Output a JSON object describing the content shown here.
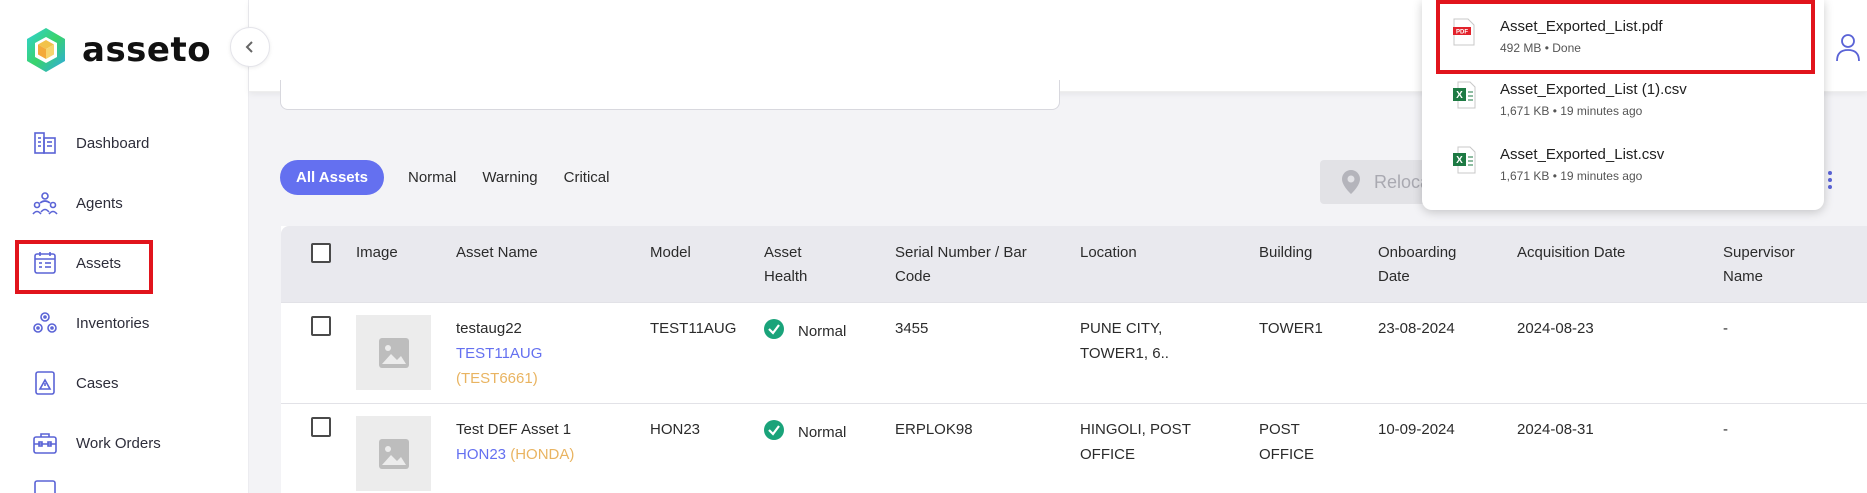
{
  "brand": {
    "name": "asseto"
  },
  "sidebar": {
    "items": [
      {
        "label": "Dashboard",
        "icon": "dashboard-icon"
      },
      {
        "label": "Agents",
        "icon": "agents-icon"
      },
      {
        "label": "Assets",
        "icon": "assets-icon",
        "highlighted": true
      },
      {
        "label": "Inventories",
        "icon": "inventories-icon"
      },
      {
        "label": "Cases",
        "icon": "cases-icon"
      },
      {
        "label": "Work Orders",
        "icon": "work-orders-icon"
      }
    ]
  },
  "tabs": [
    {
      "label": "All Assets",
      "active": true
    },
    {
      "label": "Normal"
    },
    {
      "label": "Warning"
    },
    {
      "label": "Critical"
    }
  ],
  "toolbar": {
    "relocate_label": "Reloca"
  },
  "table": {
    "headers": [
      "Image",
      "Asset Name",
      "Model",
      "Asset Health",
      "Serial Number / Bar Code",
      "Location",
      "Building",
      "Onboarding Date",
      "Acquisition Date",
      "Supervisor Name"
    ],
    "rows": [
      {
        "asset_name": "testaug22",
        "model_link": "TEST11AUG",
        "brand_link": "(TEST6661)",
        "model": "TEST11AUG",
        "health": "Normal",
        "serial": "3455",
        "location": "PUNE CITY, TOWER1, 6..",
        "building": "TOWER1",
        "onboarding": "23-08-2024",
        "acquisition": "2024-08-23",
        "supervisor": "-"
      },
      {
        "asset_name": "Test DEF Asset 1",
        "model_link": "HON23",
        "brand_link": "(HONDA)",
        "model": "HON23",
        "health": "Normal",
        "serial": "ERPLOK98",
        "location": "HINGOLI, POST OFFICE",
        "building": "POST OFFICE",
        "onboarding": "10-09-2024",
        "acquisition": "2024-08-31",
        "supervisor": "-"
      }
    ]
  },
  "downloads": {
    "items": [
      {
        "name": "Asset_Exported_List.pdf",
        "meta": "492 MB • Done",
        "type": "pdf"
      },
      {
        "name": "Asset_Exported_List (1).csv",
        "meta": "1,671 KB • 19 minutes ago",
        "type": "excel"
      },
      {
        "name": "Asset_Exported_List.csv",
        "meta": "1,671 KB • 19 minutes ago",
        "type": "excel"
      }
    ]
  },
  "colors": {
    "accent": "#6470f0",
    "highlight": "#e1141c",
    "health_ok": "#1aa37a",
    "brand_link": "#e9b461"
  }
}
